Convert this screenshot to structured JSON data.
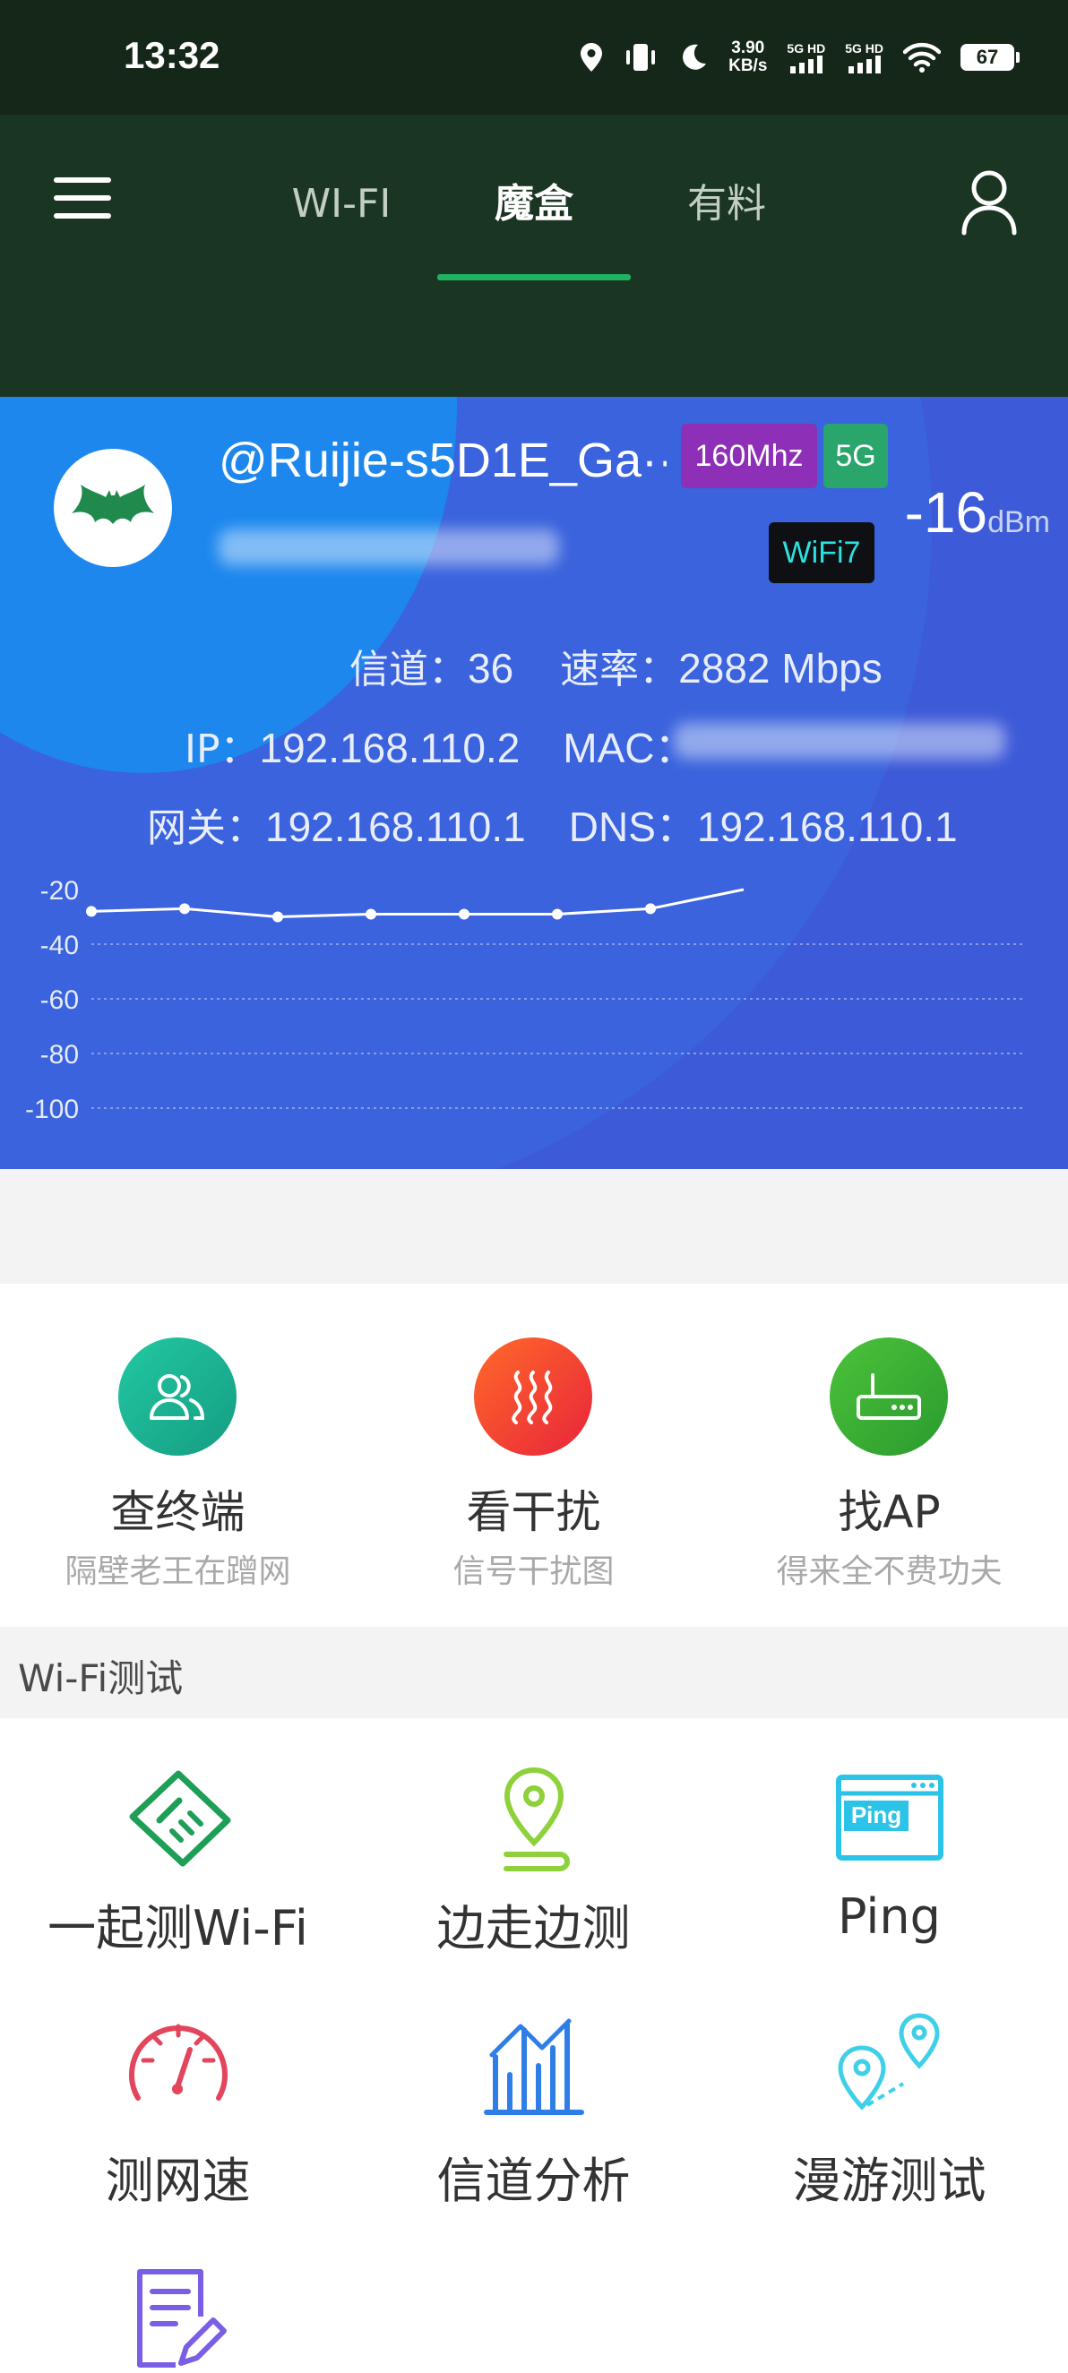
{
  "status_bar": {
    "time": "13:32",
    "net_speed_value": "3.90",
    "net_speed_unit": "KB/s",
    "sim1_label": "5G HD",
    "sim2_label": "5G HD",
    "battery": "67",
    "icons": [
      "location-icon",
      "vibrate-icon",
      "moon-icon",
      "signal-icon",
      "signal-icon",
      "wifi-icon",
      "battery-icon"
    ]
  },
  "header": {
    "tabs": [
      {
        "label": "WI-FI"
      },
      {
        "label": "魔盒"
      },
      {
        "label": "有料"
      }
    ],
    "active_tab": 1,
    "accent_color": "#1fb262"
  },
  "wifi": {
    "ssid": "@Ruijie-s5D1E_Ga··",
    "bandwidth_badge": "160Mhz",
    "band_badge": "5G",
    "standard_badge": "WiFi7",
    "rssi_value": "-16",
    "rssi_unit": "dBm",
    "channel_label": "信道：",
    "channel_value": "36",
    "rate_label": "速率：",
    "rate_value": "2882 Mbps",
    "ip_label": "IP：",
    "ip_value": "192.168.110.2",
    "mac_label": "MAC：",
    "gateway_label": "网关：",
    "gateway_value": "192.168.110.1",
    "dns_label": "DNS：",
    "dns_value": "192.168.110.1"
  },
  "chart_data": {
    "type": "line",
    "y_ticks": [
      "-20",
      "-40",
      "-60",
      "-80",
      "-100"
    ],
    "ylim": [
      -100,
      -20
    ],
    "x": [
      0,
      1,
      2,
      3,
      4,
      5,
      6,
      7
    ],
    "series": [
      {
        "values": [
          -28,
          -27,
          -30,
          -29,
          -29,
          -29,
          -27,
          -20
        ],
        "color": "#ffffff"
      }
    ],
    "grid": true
  },
  "tools": [
    {
      "title": "查终端",
      "subtitle": "隔壁老王在蹭网",
      "icon": "users-icon"
    },
    {
      "title": "看干扰",
      "subtitle": "信号干扰图",
      "icon": "heat-waves-icon"
    },
    {
      "title": "找AP",
      "subtitle": "得来全不费功夫",
      "icon": "router-icon"
    }
  ],
  "section": {
    "title": "Wi-Fi测试"
  },
  "tests": [
    {
      "label": "一起测Wi-Fi",
      "icon": "handshake-icon"
    },
    {
      "label": "边走边测",
      "icon": "map-pin-icon"
    },
    {
      "label": "Ping",
      "icon": "ping-window-icon"
    },
    {
      "label": "测网速",
      "icon": "speedometer-icon"
    },
    {
      "label": "信道分析",
      "icon": "bar-chart-icon"
    },
    {
      "label": "漫游测试",
      "icon": "roaming-pins-icon"
    }
  ]
}
